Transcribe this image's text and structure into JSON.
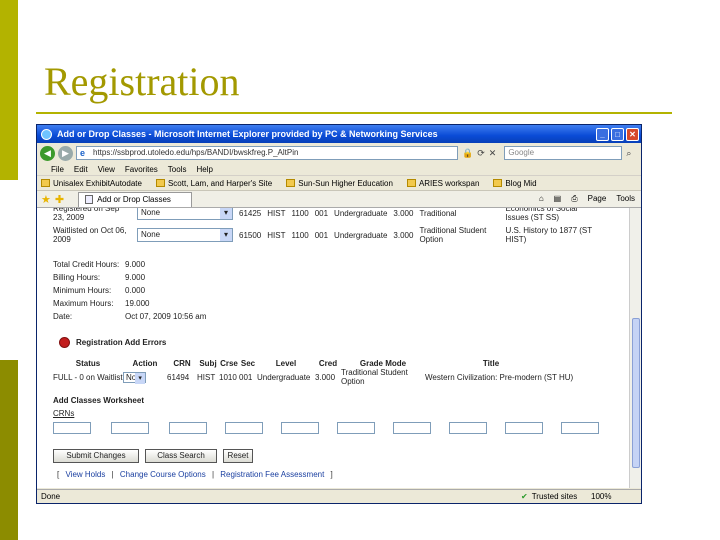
{
  "slide": {
    "title": "Registration"
  },
  "window": {
    "title": "Add or Drop Classes - Microsoft Internet Explorer provided by PC & Networking Services",
    "url": "https://ssbprod.utoledo.edu/hps/BANDI/bwskfreg.P_AltPin",
    "search_placeholder": "Google",
    "menu": [
      "File",
      "Edit",
      "View",
      "Favorites",
      "Tools",
      "Help"
    ],
    "links": [
      "Unisalex ExhibitAutodate",
      "Scott, Lam, and Harper's Site",
      "Sun-Sun Higher Education",
      "ARIES workspan",
      "Blog Mid"
    ],
    "tab_label": "Add or Drop Classes",
    "tools": [
      "Page",
      "Tools"
    ],
    "status": {
      "left": "Done",
      "zone": "Trusted sites",
      "zoom": "100%"
    }
  },
  "current_rows": [
    {
      "status": "Registered on Sep 23, 2009",
      "action": "None",
      "crn": "61425",
      "subj": "HIST",
      "crse": "1100",
      "sec": "001",
      "level": "Undergraduate",
      "cred": "3.000",
      "grade_mode": "Traditional",
      "title": "Economics of Social Issues (ST SS)"
    },
    {
      "status": "Waitlisted on Oct 06, 2009",
      "action": "None",
      "crn": "61500",
      "subj": "HIST",
      "crse": "1100",
      "sec": "001",
      "level": "Undergraduate",
      "cred": "3.000",
      "grade_mode": "Traditional Student Option",
      "title": "U.S. History to 1877 (ST HIST)"
    }
  ],
  "summary": [
    {
      "label": "Total Credit Hours:",
      "value": "9.000"
    },
    {
      "label": "Billing Hours:",
      "value": "9.000"
    },
    {
      "label": "Minimum Hours:",
      "value": "0.000"
    },
    {
      "label": "Maximum Hours:",
      "value": "19.000"
    },
    {
      "label": "Date:",
      "value": "Oct 07, 2009 10:56 am"
    }
  ],
  "errors": {
    "heading": "Registration Add Errors",
    "columns": [
      "Status",
      "Action",
      "CRN",
      "Subj",
      "Crse",
      "Sec",
      "Level",
      "Cred",
      "Grade Mode",
      "Title"
    ],
    "row": {
      "status": "FULL - 0 on Waitlist",
      "action": "None",
      "crn": "61494",
      "subj": "HIST",
      "crse": "1010",
      "sec": "001",
      "level": "Undergraduate",
      "cred": "3.000",
      "grade_mode": "Traditional Student Option",
      "title": "Western Civilization: Pre-modern (ST HU)"
    }
  },
  "worksheet": {
    "title": "Add Classes Worksheet",
    "crn_label": "CRNs"
  },
  "buttons": {
    "submit": "Submit Changes",
    "search": "Class Search",
    "reset": "Reset"
  },
  "footer_links": [
    "View Holds",
    "Change Course Options",
    "Registration Fee Assessment"
  ]
}
